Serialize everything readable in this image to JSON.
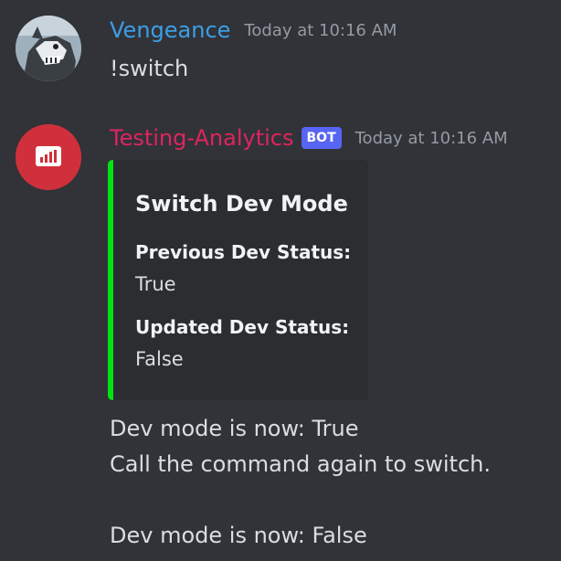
{
  "colors": {
    "background": "#313338",
    "user_name": "#3d9ee5",
    "bot_name": "#e0245e",
    "bot_tag": "#5865f2",
    "embed_accent": "#00e412",
    "embed_bg": "#2b2d31",
    "timestamp": "#949ba4"
  },
  "messages": [
    {
      "author": "Vengeance",
      "timestamp": "Today at 10:16 AM",
      "avatar_icon": "wolf-avatar-icon",
      "content": "!switch"
    },
    {
      "author": "Testing-Analytics",
      "bot_tag": "BOT",
      "timestamp": "Today at 10:16 AM",
      "avatar_icon": "bar-chart-icon",
      "embed": {
        "title": "Switch Dev Mode",
        "fields": [
          {
            "name": "Previous Dev Status:",
            "value": "True"
          },
          {
            "name": "Updated Dev Status:",
            "value": "False"
          }
        ]
      },
      "content_lines": [
        "Dev mode is now: True",
        "Call the command again to switch.",
        "",
        "Dev mode is now: False"
      ]
    }
  ]
}
